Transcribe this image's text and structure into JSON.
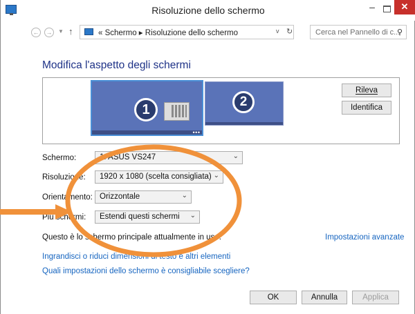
{
  "window": {
    "title": "Risoluzione dello schermo",
    "minimize": "–",
    "close": "✕"
  },
  "address": {
    "back_icon": "←",
    "forward_icon": "→",
    "up_icon": "↑",
    "crumbs": "« Schermo ▸ Risoluzione dello schermo",
    "dropdown_icon": "v",
    "refresh_icon": "↻",
    "search_placeholder": "Cerca nel Pannello di c...",
    "search_icon": "⚲"
  },
  "heading": "Modifica l'aspetto degli schermi",
  "preview": {
    "monitor1": "1",
    "monitor2": "2",
    "dots": "• • •"
  },
  "buttons": {
    "rileva": "Rileva",
    "identifica": "Identifica",
    "ok": "OK",
    "annulla": "Annulla",
    "applica": "Applica"
  },
  "form": {
    "schermo_label": "Schermo:",
    "schermo_value": "1. ASUS VS247",
    "risoluzione_label": "Risoluzione:",
    "risoluzione_value": "1920 x 1080 (scelta consigliata)",
    "orientamento_label": "Orientamento:",
    "orientamento_value": "Orizzontale",
    "piu_schermi_label": "Più schermi:",
    "piu_schermi_value": "Estendi questi schermi",
    "arrow": "⌄"
  },
  "info_text": "Questo è lo schermo principale attualmente in uso.",
  "links": {
    "avanzate": "Impostazioni avanzate",
    "ingrandisci": "Ingrandisci o riduci dimensioni di testo e altri elementi",
    "quali": "Quali impostazioni dello schermo è consigliabile scegliere?"
  },
  "colors": {
    "annotation": "#f0913a",
    "link": "#1665c0",
    "heading": "#1e3287",
    "monitor": "#5a73b8"
  }
}
